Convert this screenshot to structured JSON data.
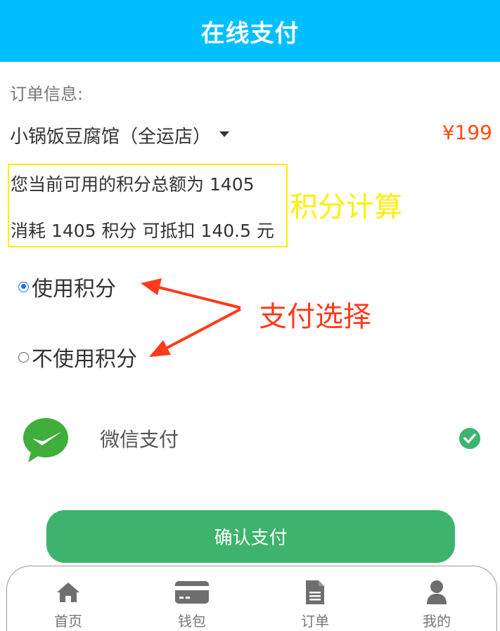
{
  "header": {
    "title": "在线支付"
  },
  "order": {
    "label": "订单信息:",
    "shop_name": "小锅饭豆腐馆（全运店）",
    "price": "¥199"
  },
  "points": {
    "available_text": "您当前可用的积分总额为 1405",
    "deduct_text": "消耗 1405 积分 可抵扣 140.5 元"
  },
  "annotations": {
    "points_calc": "积分计算",
    "payment_choice": "支付选择",
    "colors": {
      "points_calc": "#ffef00",
      "payment_choice": "#ff3b1c"
    }
  },
  "options": {
    "use_points": {
      "label": "使用积分",
      "checked": true
    },
    "no_points": {
      "label": "不使用积分",
      "checked": false
    }
  },
  "payment_method": {
    "name": "微信支付",
    "icon": "wechat-icon",
    "selected": true
  },
  "confirm_button": {
    "label": "确认支付"
  },
  "nav": {
    "items": [
      {
        "label": "首页",
        "icon": "home-icon"
      },
      {
        "label": "钱包",
        "icon": "wallet-icon"
      },
      {
        "label": "订单",
        "icon": "document-icon"
      },
      {
        "label": "我的",
        "icon": "user-icon"
      }
    ]
  },
  "colors": {
    "header_bg": "#00bfff",
    "price": "#ff4a13",
    "confirm_bg": "#3db36d",
    "radio_checked": "#1a73e8"
  }
}
